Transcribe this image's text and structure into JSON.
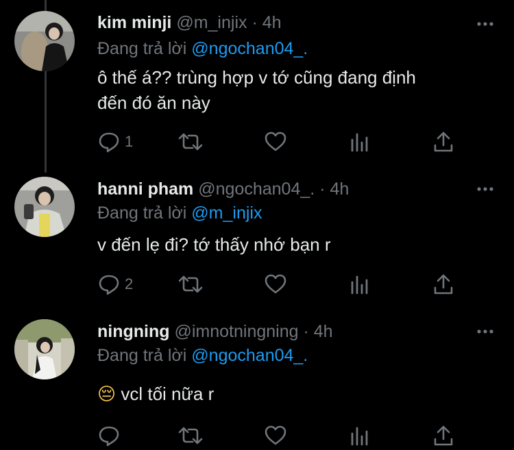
{
  "tweets": [
    {
      "name": "kim minji",
      "handle": "@m_injix",
      "dot": "·",
      "time": "4h",
      "reply_prefix": "Đang trả lời",
      "reply_to": "@ngochan04_.",
      "text_line1": "ô thế á?? trùng hợp v tớ cũng đang định",
      "text_line2": "đến đó ăn này",
      "reply_count": "1"
    },
    {
      "name": "hanni pham",
      "handle": "@ngochan04_.",
      "dot": "·",
      "time": "4h",
      "reply_prefix": "Đang trả lời",
      "reply_to": "@m_injix",
      "text_line1": "v đến lẹ đi? tớ thấy nhớ bạn r",
      "reply_count": "2"
    },
    {
      "name": "ningning",
      "handle": "@imnotningning",
      "dot": "·",
      "time": "4h",
      "reply_prefix": "Đang trả lời",
      "reply_to": "@ngochan04_.",
      "emoji": "😔",
      "text_line1": "vcl tối nữa r",
      "reply_count": ""
    }
  ],
  "icons": [
    "reply-icon",
    "retweet-icon",
    "like-icon",
    "views-icon",
    "share-icon",
    "more-icon"
  ],
  "colors": {
    "background": "#000000",
    "text": "#e7e9ea",
    "muted": "#71767b",
    "mention": "#1d9bf0"
  }
}
